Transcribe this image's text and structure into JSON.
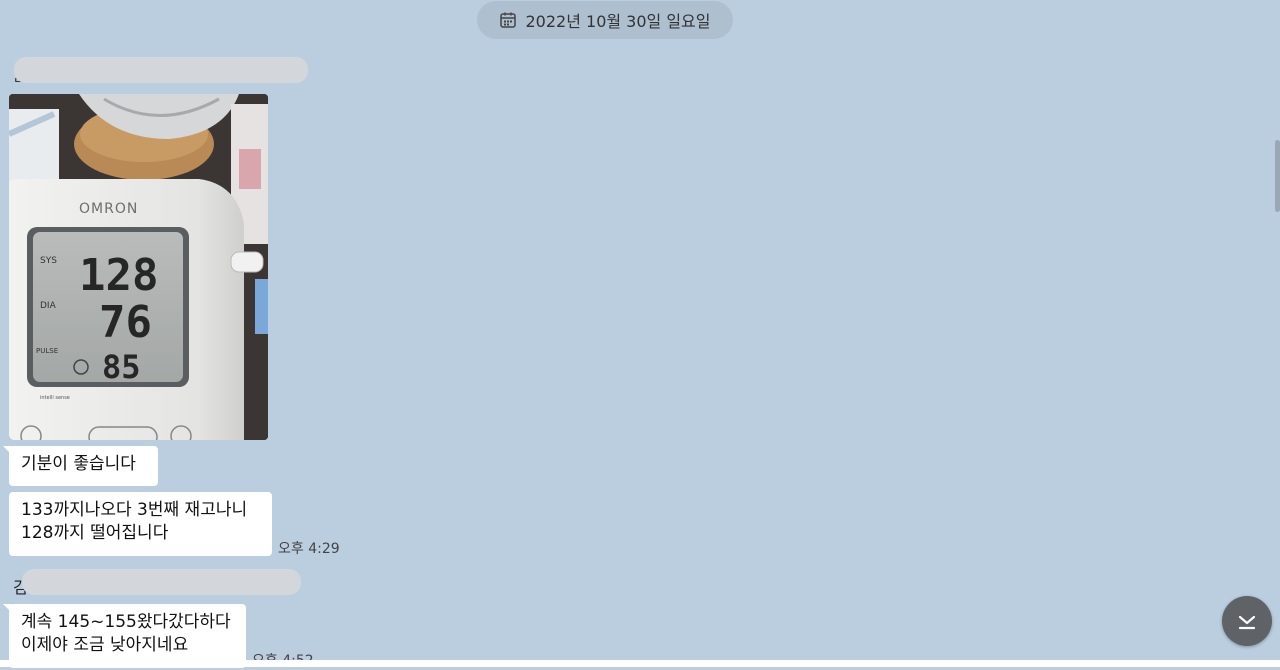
{
  "header": {
    "date": "2022년 10월 30일 일요일",
    "calendar_icon": "calendar-icon"
  },
  "messages": {
    "sender_a_partial": "ᆫ",
    "bubble1": "기분이 좋습니다",
    "bubble2": "133까지나오다 3번째 재고나니\n128까지 떨어집니다",
    "time1": "오후 4:29",
    "sender_b_partial": "김",
    "bubble3": "계속 145~155왔다갔다하다\n이제야 조금 낮아지네요",
    "time2": "오후 4:52"
  },
  "photo": {
    "brand": "OMRON",
    "sys_label": "SYS",
    "dia_label": "DIA",
    "pulse_label": "PULSE",
    "sys": "128",
    "dia": "76",
    "pulse": "85",
    "small_logo": "intelli sense"
  },
  "controls": {
    "scroll_down_icon": "scroll-to-bottom-icon"
  },
  "colors": {
    "background": "#bacee0",
    "bubble": "#ffffff",
    "pill": "#aebfd0"
  }
}
